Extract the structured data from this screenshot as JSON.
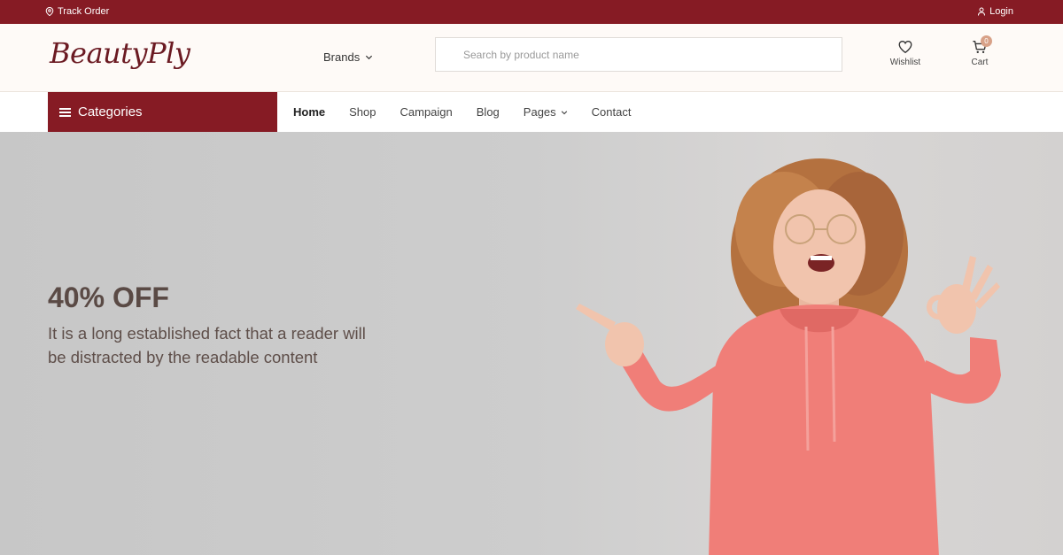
{
  "topbar": {
    "track_order": "Track Order",
    "login": "Login"
  },
  "header": {
    "logo": "BeautyPly",
    "brands": "Brands",
    "search_placeholder": "Search by product name",
    "wishlist": "Wishlist",
    "cart": "Cart",
    "cart_count": "0"
  },
  "nav": {
    "categories": "Categories",
    "links": [
      "Home",
      "Shop",
      "Campaign",
      "Blog",
      "Pages",
      "Contact"
    ]
  },
  "hero": {
    "title": "40% OFF",
    "text": "It is a long established fact that a reader will be distracted by the readable content"
  },
  "colors": {
    "brand": "#861b24",
    "badge": "#d8a188"
  }
}
